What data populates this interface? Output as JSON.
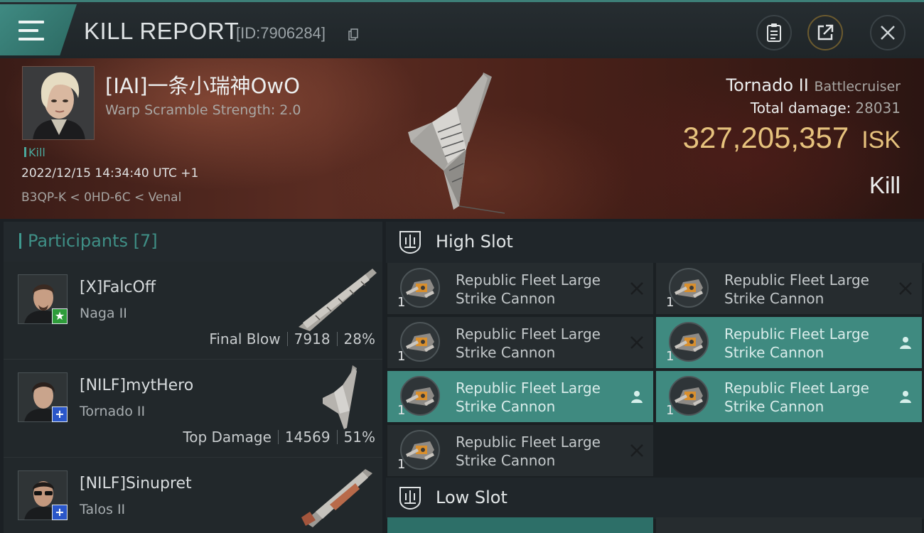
{
  "header": {
    "title": "KILL REPORT",
    "report_id": "[ID:7906284]",
    "icons": [
      "menu-icon",
      "copy-icon",
      "clipboard-icon",
      "share-icon",
      "close-icon"
    ]
  },
  "victim": {
    "name": "[IAI]一条小瑞神OwO",
    "warp_scramble": "Warp Scramble Strength: 2.0",
    "tag": "Kill",
    "timestamp": "2022/12/15 14:34:40 UTC +1",
    "location": "B3QP-K < 0HD-6C < Venal",
    "ship_name": "Tornado II",
    "ship_class": "Battlecruiser",
    "total_damage_label": "Total damage:",
    "total_damage": "28031",
    "isk_value": "327,205,357",
    "isk_unit": "ISK",
    "result": "Kill"
  },
  "participants": {
    "title": "Participants [7]",
    "items": [
      {
        "name": "[X]FalcOff",
        "ship": "Naga II",
        "role": "Final Blow",
        "damage": "7918",
        "percent": "28%",
        "badge": "star",
        "badge_color": "#2e9c3a"
      },
      {
        "name": "[NILF]mytHero",
        "ship": "Tornado II",
        "role": "Top Damage",
        "damage": "14569",
        "percent": "51%",
        "badge": "plus",
        "badge_color": "#2a56c9"
      },
      {
        "name": "[NILF]Sinupret",
        "ship": "Talos II",
        "badge": "plus",
        "badge_color": "#2a56c9"
      }
    ]
  },
  "fitting": {
    "high_slot_label": "High Slot",
    "low_slot_label": "Low Slot",
    "high_slot_modules": [
      {
        "line1": "Republic Fleet Large",
        "line2": "Strike Cannon",
        "qty": "1",
        "status": "destroyed"
      },
      {
        "line1": "Republic Fleet Large",
        "line2": "Strike Cannon",
        "qty": "1",
        "status": "destroyed"
      },
      {
        "line1": "Republic Fleet Large",
        "line2": "Strike Cannon",
        "qty": "1",
        "status": "destroyed"
      },
      {
        "line1": "Republic Fleet Large",
        "line2": "Strike Cannon",
        "qty": "1",
        "status": "dropped"
      },
      {
        "line1": "Republic Fleet Large",
        "line2": "Strike Cannon",
        "qty": "1",
        "status": "dropped"
      },
      {
        "line1": "Republic Fleet Large",
        "line2": "Strike Cannon",
        "qty": "1",
        "status": "dropped"
      },
      {
        "line1": "Republic Fleet Large",
        "line2": "Strike Cannon",
        "qty": "1",
        "status": "destroyed"
      }
    ]
  },
  "colors": {
    "accent": "#3f8a80",
    "isk": "#e6c27d",
    "banner": "#4a2119"
  }
}
